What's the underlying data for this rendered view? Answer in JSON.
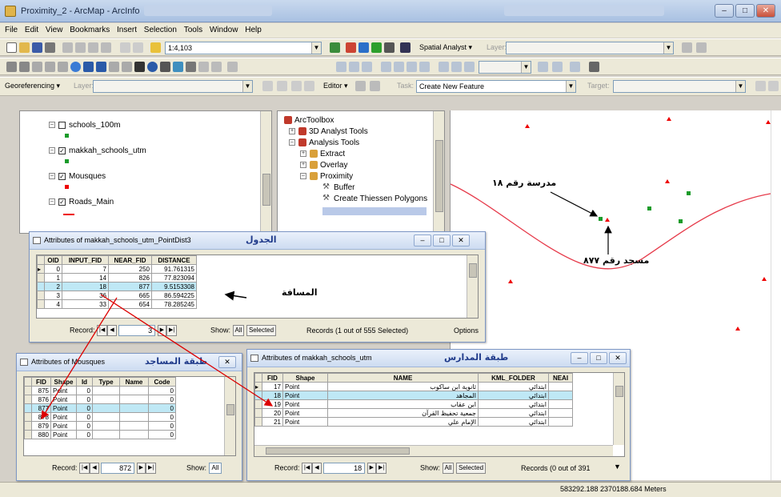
{
  "window": {
    "title": "Proximity_2 - ArcMap - ArcInfo",
    "min": "–",
    "max": "□",
    "close": "✕"
  },
  "menus": [
    "File",
    "Edit",
    "View",
    "Bookmarks",
    "Insert",
    "Selection",
    "Tools",
    "Window",
    "Help"
  ],
  "toolbar1": {
    "scale": "1:4,103",
    "spatial_analyst": "Spatial Analyst ▾",
    "layer_label": "Layer:"
  },
  "toolbar3": {
    "georef": "Georeferencing ▾",
    "layer_label": "Layer:",
    "editor": "Editor ▾",
    "task_label": "Task:",
    "task_value": "Create New Feature",
    "target_label": "Target:"
  },
  "toc": {
    "layers": [
      {
        "name": "schools_100m",
        "checked": false,
        "symbol_color": "#1a9b2a"
      },
      {
        "name": "makkah_schools_utm",
        "checked": true,
        "symbol_color": "#1a9b2a"
      },
      {
        "name": "Mousques",
        "checked": true,
        "symbol_color": "#e00000"
      },
      {
        "name": "Roads_Main",
        "checked": true,
        "symbol_color": "#e00000"
      }
    ]
  },
  "toolbox": {
    "items": [
      "ArcToolbox",
      "3D Analyst Tools",
      "Analysis Tools",
      "Extract",
      "Overlay",
      "Proximity",
      "Buffer",
      "Create Thiessen Polygons"
    ]
  },
  "map_labels": {
    "school": "مدرسة رقم ١٨",
    "mosque": "مسجد رقم ٨٧٧",
    "distance": "المسافة",
    "table_label": "الجدول",
    "mosques_layer": "طبقة المساجد",
    "schools_layer": "طبقة المدارس"
  },
  "status": {
    "coords": "583292.188  2370188.684 Meters"
  },
  "point_dist": {
    "title": "Attributes of makkah_schools_utm_PointDist3",
    "columns": [
      "OID",
      "INPUT_FID",
      "NEAR_FID",
      "DISTANCE"
    ],
    "rows": [
      [
        "0",
        "7",
        "250",
        "91.761315"
      ],
      [
        "1",
        "14",
        "826",
        "77.823094"
      ],
      [
        "2",
        "18",
        "877",
        "9.5153308"
      ],
      [
        "3",
        "36",
        "665",
        "86.594225"
      ],
      [
        "4",
        "33",
        "654",
        "78.285245"
      ]
    ],
    "record_label": "Record:",
    "record_value": "3",
    "show_label": "Show:",
    "all": "All",
    "selected": "Selected",
    "records_info": "Records (1 out of 555 Selected)",
    "options": "Options"
  },
  "mosques": {
    "title": "Attributes of Mousques",
    "columns": [
      "FID",
      "Shape",
      "Id",
      "Type",
      "Name",
      "Code"
    ],
    "rows": [
      [
        "875",
        "Point",
        "0",
        "",
        "",
        "0"
      ],
      [
        "876",
        "Point",
        "0",
        "",
        "",
        "0"
      ],
      [
        "877",
        "Point",
        "0",
        "",
        "",
        "0"
      ],
      [
        "878",
        "Point",
        "0",
        "",
        "",
        "0"
      ],
      [
        "879",
        "Point",
        "0",
        "",
        "",
        "0"
      ],
      [
        "880",
        "Point",
        "0",
        "",
        "",
        "0"
      ]
    ],
    "record_label": "Record:",
    "record_value": "872",
    "show_label": "Show:",
    "all": "All"
  },
  "schools": {
    "title": "Attributes of makkah_schools_utm",
    "columns": [
      "FID",
      "Shape",
      "NAME",
      "KML_FOLDER",
      "NEAI"
    ],
    "rows": [
      [
        "17",
        "Point",
        "ثانوية ابن ساكوب",
        "ابتدائي",
        ""
      ],
      [
        "18",
        "Point",
        "المجاهد",
        "ابتدائي",
        ""
      ],
      [
        "19",
        "Point",
        "ابن عقاب",
        "ابتدائي",
        ""
      ],
      [
        "20",
        "Point",
        "جمعية تحفيظ القرآن",
        "ابتدائي",
        ""
      ],
      [
        "21",
        "Point",
        "الإمام علي",
        "ابتدائي",
        ""
      ]
    ],
    "record_label": "Record:",
    "record_value": "18",
    "show_label": "Show:",
    "all": "All",
    "selected": "Selected",
    "records_info": "Records (0 out of 391"
  }
}
